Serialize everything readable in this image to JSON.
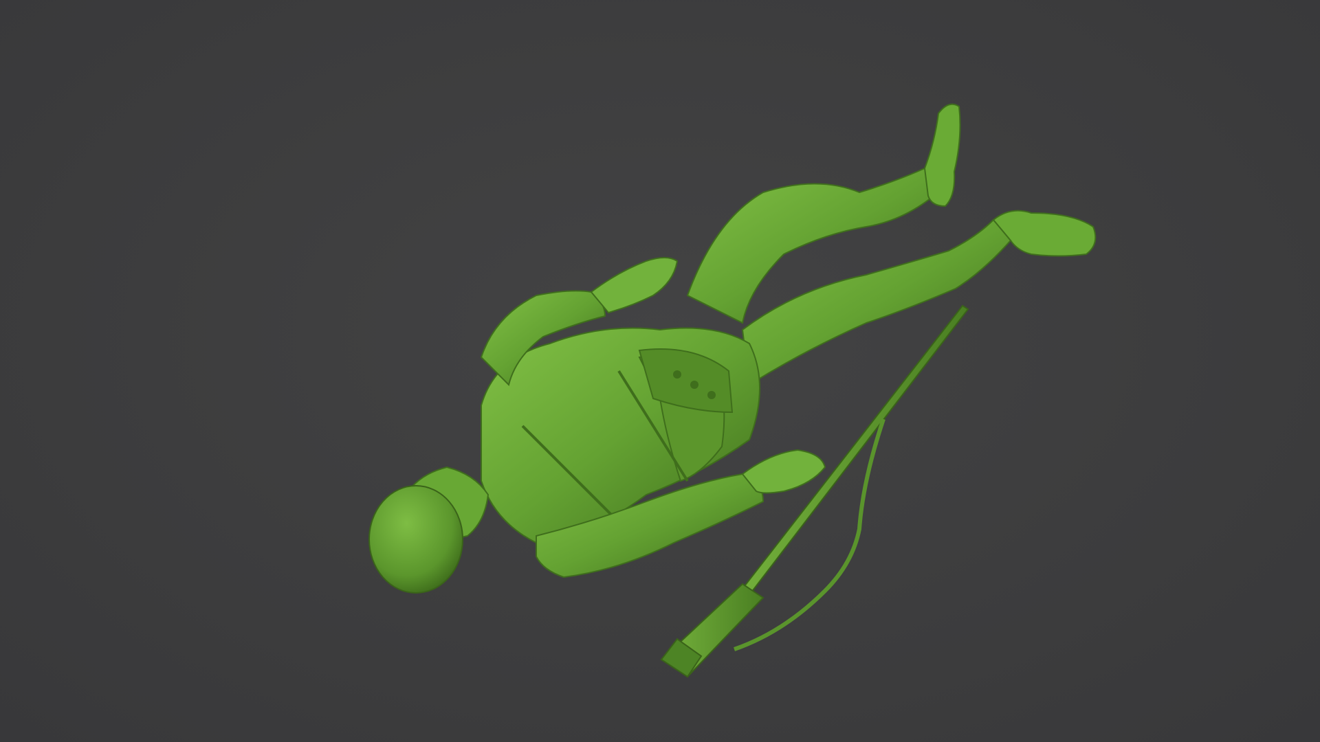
{
  "scene": {
    "subject": "",
    "background_color": "#3d3d3e",
    "model_color": "#5f9a2f",
    "model_highlight": "#7cba42",
    "model_shadow": "#3f6e1c"
  }
}
